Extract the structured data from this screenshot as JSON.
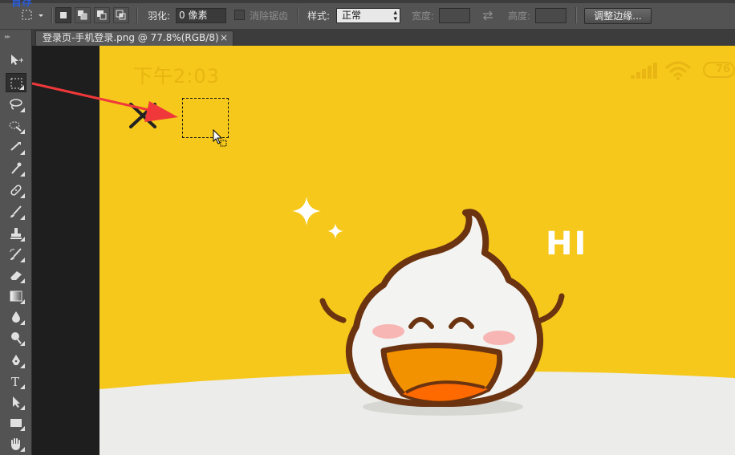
{
  "window_title_fragment": "首存",
  "options_bar": {
    "feather_label": "羽化:",
    "feather_value": "0 像素",
    "antialias_label": "消除锯齿",
    "style_label": "样式:",
    "style_value": "正常",
    "width_label": "宽度:",
    "height_label": "高度:",
    "refine_edge_button": "调整边缘..."
  },
  "document_tab": {
    "title": "登录页-手机登录.png @ 77.8%(RGB/8)",
    "close": "×"
  },
  "tools": [
    "move-tool",
    "rectangular-marquee-tool",
    "lasso-tool",
    "quick-selection-tool",
    "crop-tool",
    "eyedropper-tool",
    "spot-healing-brush-tool",
    "brush-tool",
    "clone-stamp-tool",
    "history-brush-tool",
    "eraser-tool",
    "gradient-tool",
    "blur-tool",
    "dodge-tool",
    "pen-tool",
    "type-tool",
    "path-selection-tool",
    "rectangle-tool",
    "hand-tool"
  ],
  "canvas": {
    "status_time": "下午2:03",
    "battery_level": "76",
    "hi_text": "HI",
    "close_glyph": "✕",
    "colors": {
      "background": "#f5c81b",
      "ground": "#ececea",
      "mascot_outline": "#6b3310",
      "mouth": "#f39200"
    }
  },
  "annotation": {
    "arrow_color": "#f0383a"
  }
}
